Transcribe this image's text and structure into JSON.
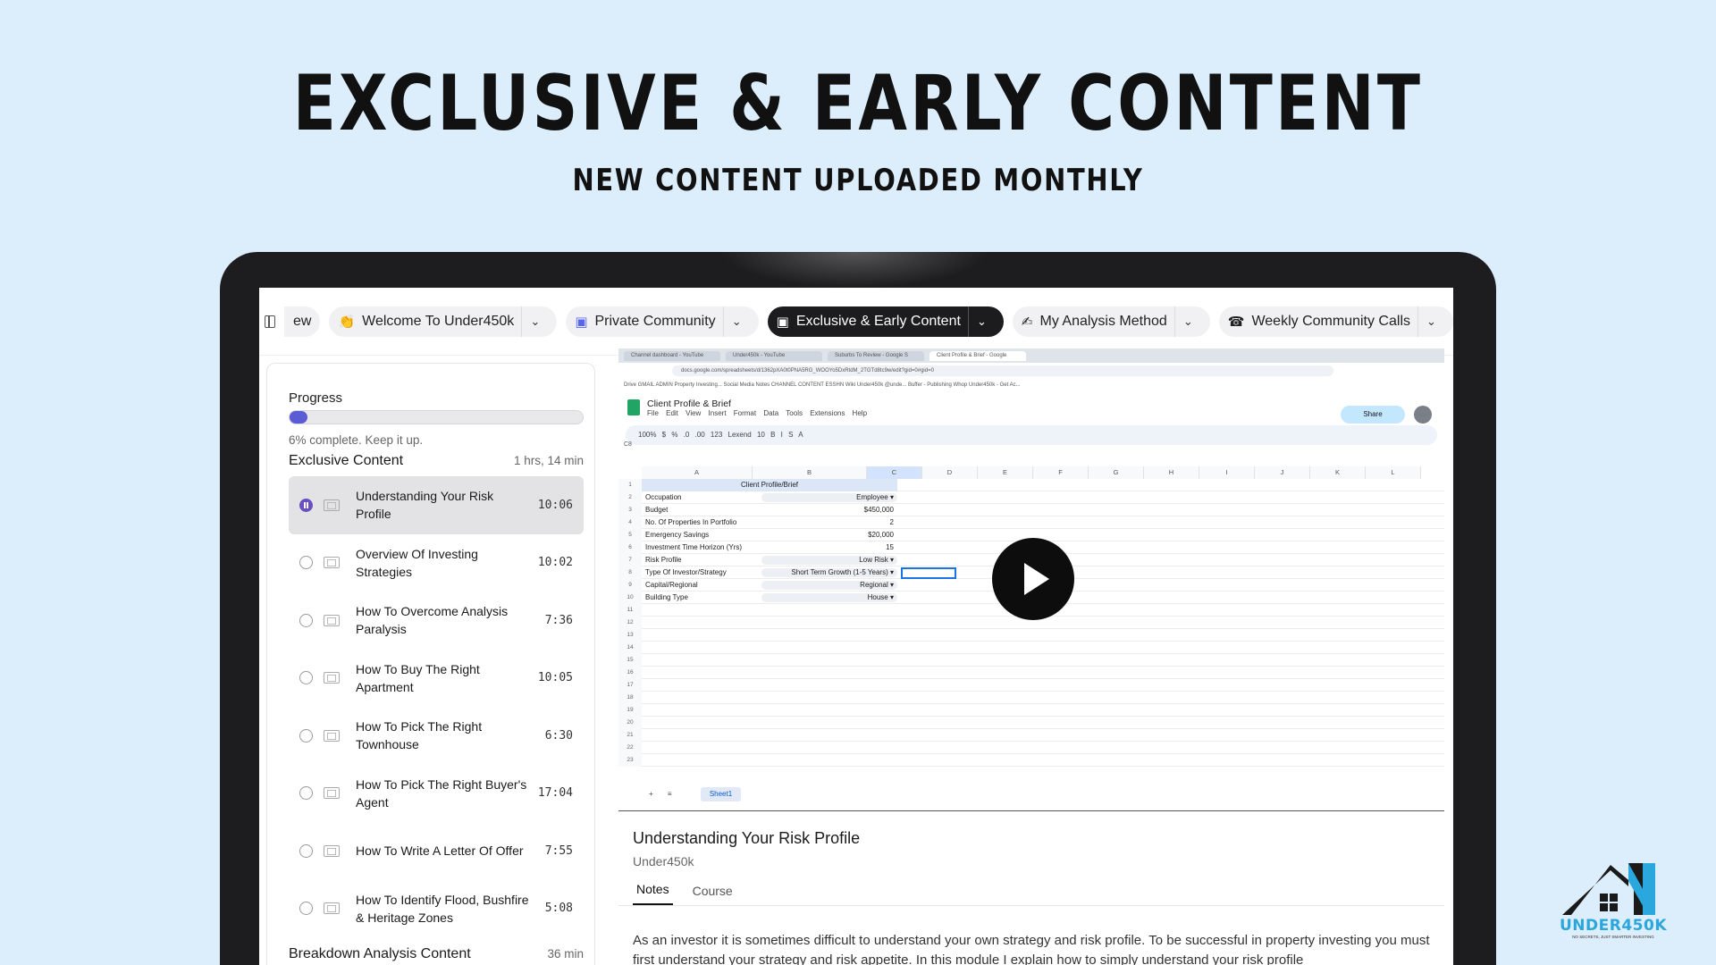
{
  "hero": {
    "title": "EXCLUSIVE & EARLY CONTENT",
    "subtitle": "NEW CONTENT UPLOADED MONTHLY"
  },
  "tabs": [
    {
      "label": "ew",
      "icon": "",
      "active": false,
      "partial": true
    },
    {
      "label": "Welcome To Under450k",
      "icon": "party-icon",
      "active": false
    },
    {
      "label": "Private Community",
      "icon": "discord-icon",
      "active": false
    },
    {
      "label": "Exclusive & Early Content",
      "icon": "discord-icon",
      "active": true
    },
    {
      "label": "My Analysis Method",
      "icon": "pencil-icon",
      "active": false
    },
    {
      "label": "Weekly Community Calls",
      "icon": "phone-icon",
      "active": false
    }
  ],
  "sidebar": {
    "progress_label": "Progress",
    "progress_percent": 6,
    "progress_text": "6% complete. Keep it up.",
    "section_title": "Exclusive Content",
    "section_duration": "1 hrs, 14 min",
    "lessons": [
      {
        "title": "Understanding Your Risk Profile",
        "duration": "10:06",
        "active": true
      },
      {
        "title": "Overview Of Investing Strategies",
        "duration": "10:02",
        "active": false
      },
      {
        "title": "How To Overcome Analysis Paralysis",
        "duration": "7:36",
        "active": false
      },
      {
        "title": "How To Buy The Right Apartment",
        "duration": "10:05",
        "active": false
      },
      {
        "title": "How To Pick The Right Townhouse",
        "duration": "6:30",
        "active": false
      },
      {
        "title": "How To Pick The Right Buyer's Agent",
        "duration": "17:04",
        "active": false
      },
      {
        "title": "How To Write A Letter Of Offer",
        "duration": "7:55",
        "active": false
      },
      {
        "title": "How To Identify Flood, Bushfire & Heritage Zones",
        "duration": "5:08",
        "active": false
      }
    ],
    "next_section_title": "Breakdown Analysis Content",
    "next_section_duration": "36 min"
  },
  "video": {
    "browser_tabs": [
      "Channel dashboard - YouTube",
      "Under450k - YouTube",
      "Suburbs To Review - Google S",
      "Client Profile & Brief - Google"
    ],
    "url": "docs.google.com/spreadsheets/d/1362pXA0t0PNA5RG_WOOYo5DxRtdM_2TGTd8tc9w/edit?gid=0#gid=0",
    "bookmarks": "Drive  GMAIL  ADMIN  Property Investing...  Social Media  Notes  CHANNEL  CONTENT  ESSHN  Wiki  Under450k @unde...  Buffer - Publishing  Whop  Under450k - Get Ac...",
    "sheet_title": "Client Profile & Brief",
    "menu": "File Edit View Insert Format Data Tools Extensions Help",
    "share_label": "Share",
    "toolbar": "100%  $  %  .0  .00  123  Lexend  10  B  I  S  A",
    "cell_ref": "C8",
    "columns": [
      "A",
      "B",
      "C",
      "D",
      "E",
      "F",
      "G",
      "H",
      "I",
      "J",
      "K",
      "L"
    ],
    "table_title": "Client Profile/Brief",
    "rows": [
      {
        "label": "Occupation",
        "value": "Employee",
        "dropdown": true
      },
      {
        "label": "Budget",
        "value": "$450,000",
        "dropdown": false
      },
      {
        "label": "No. Of Properties In Portfolio",
        "value": "2",
        "dropdown": false
      },
      {
        "label": "Emergency Savings",
        "value": "$20,000",
        "dropdown": false
      },
      {
        "label": "Investment Time Horizon (Yrs)",
        "value": "15",
        "dropdown": false
      },
      {
        "label": "Risk Profile",
        "value": "Low Risk",
        "dropdown": true
      },
      {
        "label": "Type Of Investor/Strategy",
        "value": "Short Term Growth (1-5 Years)",
        "dropdown": true
      },
      {
        "label": "Capital/Regional",
        "value": "Regional",
        "dropdown": true
      },
      {
        "label": "Building Type",
        "value": "House",
        "dropdown": true
      }
    ],
    "row_count": 23,
    "sheet_tab": "Sheet1"
  },
  "lesson_detail": {
    "title": "Understanding Your Risk Profile",
    "author": "Under450k",
    "tabs": [
      "Notes",
      "Course"
    ],
    "active_tab": "Notes",
    "body": "As an investor it is sometimes difficult to understand your own strategy and risk profile. To be successful in property investing you must first understand your strategy and risk appetite. In this module I explain how to simply understand your risk profile"
  },
  "logo": {
    "text": "UNDER450K",
    "tagline": "NO SECRETS, JUST SMARTER INVESTING"
  },
  "colors": {
    "background": "#dcedfb",
    "accent": "#5b5bd6",
    "active_tab": "#1c1c1e",
    "logo_blue": "#2aa7dd"
  }
}
